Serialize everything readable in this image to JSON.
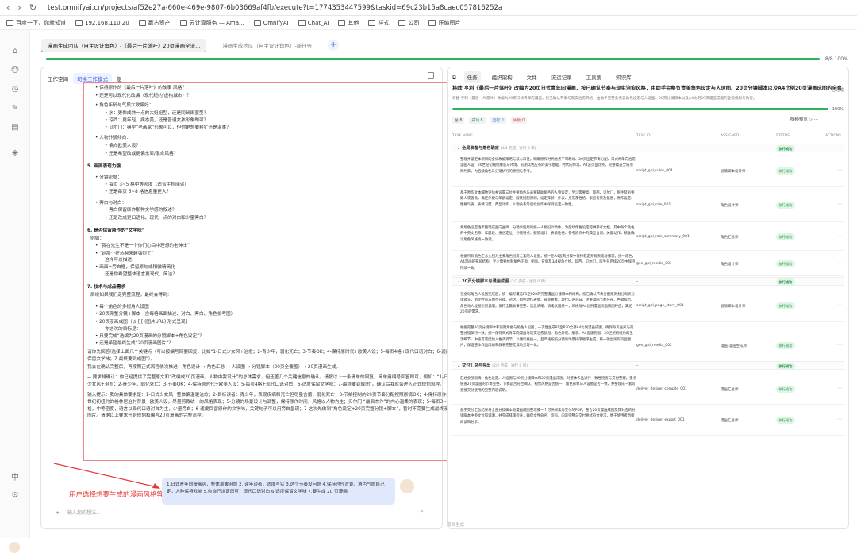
{
  "browser": {
    "url": "test.omnifyai.cn/projects/af52e27a-660e-469e-9807-6b03669af4fb/execute?t=1774353447599&taskid=69c23b15a8caec057816252a",
    "bookmarks": [
      "百度一下，你就知道",
      "192.168.110.20",
      "赢古资产",
      "云计算服务 — Ama...",
      "OmnifyAI",
      "Chat_AI",
      "其他",
      "样式",
      "公司",
      "压缩图片"
    ]
  },
  "tabs": [
    {
      "label": "漫画生成团队（自主设计角色）-《最后一片落叶》20页漫画全流...",
      "active": true
    },
    {
      "label": "漫画生成团队（自主设计角色）-新任务",
      "active": false
    }
  ],
  "progress": {
    "value": 1.0,
    "label": "8/8 100%"
  },
  "left": {
    "workspace_label": "工作空间",
    "mode_label": "切换工作模式",
    "menu_label": "急",
    "doc_lines": [
      "• 保持原作的《最后一片落叶》的故事 风格？",
      "• 还是可以现代化改编（现代纽约/虚构城市）？",
      "• 角色年龄与气质大致偏好：",
      "  • 水：更像成熟一点的大姐姐型，还是同龄闺蜜型？",
      "  • 琼西：更年轻、病态美，还是普通女孩形象即可？",
      "  • 贝尔门：典型“老画家”形象可以，但你更想要粗犷还是温柔？",
      "• 人物外貌倾向：",
      "  • 偏向欧美人设？",
      "  • 还是希望改成更偏东亚/混合风格？",
      "5. 画面表现力强",
      "• 分镜密度：",
      "  • 每页 3~5 格中等密度（适合手机阅读）",
      "  • 还是每页 6~8 格信息量更大？",
      "• 旁白与对白：",
      "  • 旁白保留原作那种文学感的叙述？",
      "  • 还是改成更口语化、现代一点的对白和少量旁白？",
      "6. 是否保留原作的“文学味”",
      "例如：",
      "• “我在先生不是一个你们心目中理想的老绅士”",
      "• “她那个狂热越来越强烈了”",
      "  这样可以描述:",
      "• 画面+旁白框，保留原句或稍微精简化",
      "  还是你希望整体语言更现代、简洁？",
      "7. 技术与成品需求",
      "后续如果我们走完整流程，最终会得到：",
      "• 每个角色的多视角人设图",
      "• 20页完整分镜+脚本（含每格画面描述、对白、旁白、角色参考图）",
      "• 20页漫画成图（以 [ [ (图片URL) 形式呈现]",
      "  你这次的目标是：",
      "• 只要完成“选编为20页漫画的分镜脚本+角色设定”？",
      "• 还是希望最终生成“20页漫画图片”？",
      "请你先回答/选择上面几个关键点（可以按编号简要回复，比如“1-日式少女风+治愈；2-青少年，弱化死亡；3-节奏OK；4-保持原时代+欧美人设；5-每页4格+现代口语对白；6-适度保留文学味；7-最终要到成图”）。",
      "我会在确认完整后，再按照正式流程依次推进：角色设计 → 角色汇总 → 人设图 → 分镜脚本（20页全覆盖）→ 20页漫画生成。",
      "→ 要求排确认：你已经提供了完整原文和“改编成20页漫画，人物由我设计”的总体需求，但还差几个关键信息的确认。请按以上一条清单的回复，简单用编号回答即可，例如：“1-日式少女风+治愈；2-青少年，弱化死亡；3-节奏OK；4-保持原时代+欧美人设；5-每页4格+现代口语对白；6-适度保留文学味；7-最终要到成图”。确认后我就会进入正式规划流程。",
      "输入提示：我的具体要求是：1-日式少女风+整体偏温暖治愈；2-目标读者：青少年，表现疾病和死亡但尽量含蓄，弱化死亡；3-节拍控制的20页节奏分配按照原情OK；4-保持原作20世纪初纽约的格林尼治村背景+欧美人设，尽量剪裁统一的风格表现；5-分镜的场景设计与调整，保持原作时间，风格以人物为主；贝尔门 “最后杰作”的内心温柔的表现；5-每页3~5格，中等密度，语言以现代口语对白为主，少量旁白；6-适度保留原作的文学味，关键句子可以用旁白呈现；7-这次先做到“角色设定+20页完整分镜+脚本”，暂时不需要生成最终漫画图片。请据以上要求开始规划和编写20页漫画的完整流程。"
    ],
    "doc_time": "29s",
    "annotation": "用户选择想要生成的漫画风格等",
    "user_message": "1.日式青年向漫画风，整体温暖治愈 2. 读年读者，适度写实 3.这个节奏没问题 4.保持时代背景，角色气质自己定，人种保持欧美 5.你自己决定即可，现代口语对白 6.适度保留文学味 7.要生成 20 页漫画",
    "input_placeholder": "输入您的想法..."
  },
  "right": {
    "tabs": [
      "任务",
      "组织架构",
      "文件",
      "流运记录",
      "工具集",
      "知识库"
    ],
    "title": "将欧 亨利《最后一片落叶》改编为20页日式青年向漫画，按已确认节奏与现实治愈风格，由助手完整负责美角色设定与人设图、20页分镜脚本以及A4比例20页漫画成图的全套规划与执行。",
    "subtitle": "将欧·亨利《最后一片落叶》改编为20页日式青年向漫画，按已确认节奏与现实治愈风格，由助手完整负责美角色设定与人设图、20页分镜脚本以及A4比例20页漫画成图的全套规划与执行。",
    "save_label": "已完成",
    "progress": {
      "value": 1.0,
      "label": "100%"
    },
    "stats": [
      "总 8",
      "成功 8",
      "运行 0",
      "失败 0"
    ],
    "view_label": "视频预览",
    "columns": [
      "TASK NAME",
      "TASK ID",
      "ASSIGNED",
      "STATUS",
      "ACTIONS"
    ],
    "groups": [
      {
        "name": "全局准备与角色确定",
        "meta": "(4/4 完成 · 进行 0 项)",
        "rows": [
          {
            "desc": "整理并锁定本项目的全局改编策略与核心口径。明确原作时代地点不可改动、20页固定节奏分配、日式青年向治愈漫画人设、20世纪初纽约服装与环境、前期兵色应有的美学基础、时代的体现、A4竖页面比例，完整覆盖全局项目约束，为后续角色与分镜执行的原则与参考。",
            "id": "script_gbl_rules_001",
            "assigned": "剧情脚本设计师",
            "status": "执行成功"
          },
          {
            "desc": "基于原作文本细致评估并设置三位主要角色与必要辅助角色的人物设定，至少需要高、琼西、贝尔门，医生及必要路人或者角。确定外貌与年龄设定、服装搭配原则，设定年龄、外表、身形及性格、家庭背景及氛围，原作设定、性格气质、表情习惯、典型动作、人物关系等后续创作中保持设定一致性。",
            "id": "script_gbl_role_001",
            "assigned": "角色设计师",
            "status": "执行成功"
          },
          {
            "desc": "将角色设定逐步整理成面向画师、分镜手使用的统一人物设计稿件，为后续角色设定提供参考文档，其中每个角色的中英文名称、年龄段、身份定位、外貌特点、服装设计、表情性格、参考原作中的典型台词、关键动作，精准确认角色风格统一协调。",
            "id": "script_gbl_role_summary_001",
            "assigned": "角色汇总师",
            "status": "执行成功"
          },
          {
            "desc": "根据所有角色汇总文档为主要角色创建全套的人设图，统一在A4竖向分镜中保持稳定外观表现与服装，统一角色，A4漫画的布局结构，至少需要绘制角色正面、侧面、背面及3/4视角立绘、琼西、贝尔门，医生在后续20页中保持持续一致。",
            "id": "gen_gbl_media_001",
            "assigned": "角色设计师",
            "status": "执行成功"
          }
        ]
      },
      {
        "name": "20页分镜脚本与漫画成图",
        "meta": "(2/2 完成 · 进行 0 项)",
        "rows": [
          {
            "desc": "在全局角色人设图完成后，统一编写覆盖P1至P20的完整漫画分镜脚本和结构。按已确认节奏分配原则划分每页分镜镜头，制定时间与地点分镜、对话、角色动作表情、背景要素、现代口语对白、注重漫画节奏分布、色调提示、角色与人设图引用说明，保持全篇故事完整、信息清晰、情绪氛围统一，风格与A4比例漫画页面构图呼应，满足20页的需求。",
            "id": "script_gbl_page_story_001",
            "assigned": "剧情脚本设计师",
            "status": "执行成功"
          },
          {
            "desc": "根据完整20页分镜脚本和前期角色与角色人设图，一次性生成P1至P20全部A4比例漫画成图，确保每页画风与完整分镜保持一致，统一保持日式青年向漫画与现实治愈氛围、角色外观、服装、A4竖版构图、20世纪初纽约的生活细节，中途可适度加入色调调节，以便风格统一。且严格按照分镜的场景排序顺序生成，统一输出所有页面图片，保证整体作品风格和叙事完整无误地呈现一体。",
            "id": "gen_gbl_media_002",
            "assigned": "漫画-漫画生成师",
            "status": "执行成功"
          }
        ]
      },
      {
        "name": "交付汇总与导出",
        "meta": "(2/2 完成 · 进行 0 项)",
        "rows": [
          {
            "desc": "汇总全部剧情、角色设定、人设图与20页分镜脚本和20页漫画成图，对整体作品进行一致性检查与交付整理，重点核查20页漫画的节奏完整、节奏是否符合确认，视觉风格是否统一，角色形象与人设图是否一致，并整理成一套可直接交付使用的完整内容说明。",
            "id": "deliver_deliver_compile_001",
            "assigned": "漫画汇总师",
            "status": "执行成功"
          },
          {
            "desc": "基于交付汇总结果将全部分镜脚本与漫画成图整理成一个可供阅读与交付的PDF，整合20页漫画成图及其对应的分镜脚本中英文对照说明，并完成排版检查，确保文件命名、页码、内容完整与交付格式符合要求，便于使用者直接阅读和分享。",
            "id": "deliver_deliver_export_001",
            "assigned": "漫画汇总师",
            "status": "执行成功"
          }
        ]
      }
    ]
  },
  "bottom_tag": "漫画生成"
}
